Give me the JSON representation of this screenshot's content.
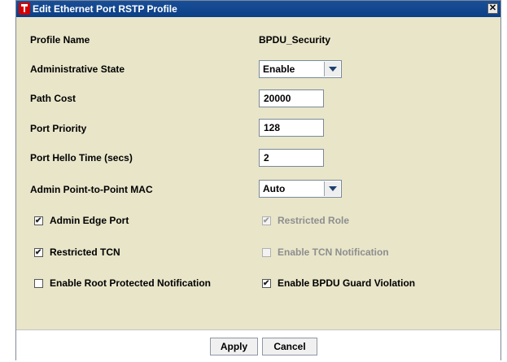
{
  "window": {
    "title": "Edit Ethernet Port RSTP Profile"
  },
  "fields": {
    "profile_name": {
      "label": "Profile Name",
      "value": "BPDU_Security"
    },
    "admin_state": {
      "label": "Administrative State",
      "value": "Enable"
    },
    "path_cost": {
      "label": "Path Cost",
      "value": "20000"
    },
    "port_priority": {
      "label": "Port Priority",
      "value": "128"
    },
    "hello_time": {
      "label": "Port Hello Time (secs)",
      "value": "2"
    },
    "p2p_mac": {
      "label": "Admin Point-to-Point MAC",
      "value": "Auto"
    }
  },
  "checkboxes": {
    "admin_edge_port": {
      "label": "Admin Edge Port",
      "checked": true,
      "enabled": true
    },
    "restricted_role": {
      "label": "Restricted Role",
      "checked": true,
      "enabled": false
    },
    "restricted_tcn": {
      "label": "Restricted TCN",
      "checked": true,
      "enabled": true
    },
    "enable_tcn_notification": {
      "label": "Enable TCN Notification",
      "checked": false,
      "enabled": false
    },
    "root_protected_notification": {
      "label": "Enable Root Protected Notification",
      "checked": false,
      "enabled": true
    },
    "bpdu_guard_violation": {
      "label": "Enable BPDU Guard Violation",
      "checked": true,
      "enabled": true
    }
  },
  "buttons": {
    "apply": "Apply",
    "cancel": "Cancel"
  },
  "colors": {
    "dialog_bg": "#e8e5c9",
    "titlebar": "#0b3f86"
  }
}
